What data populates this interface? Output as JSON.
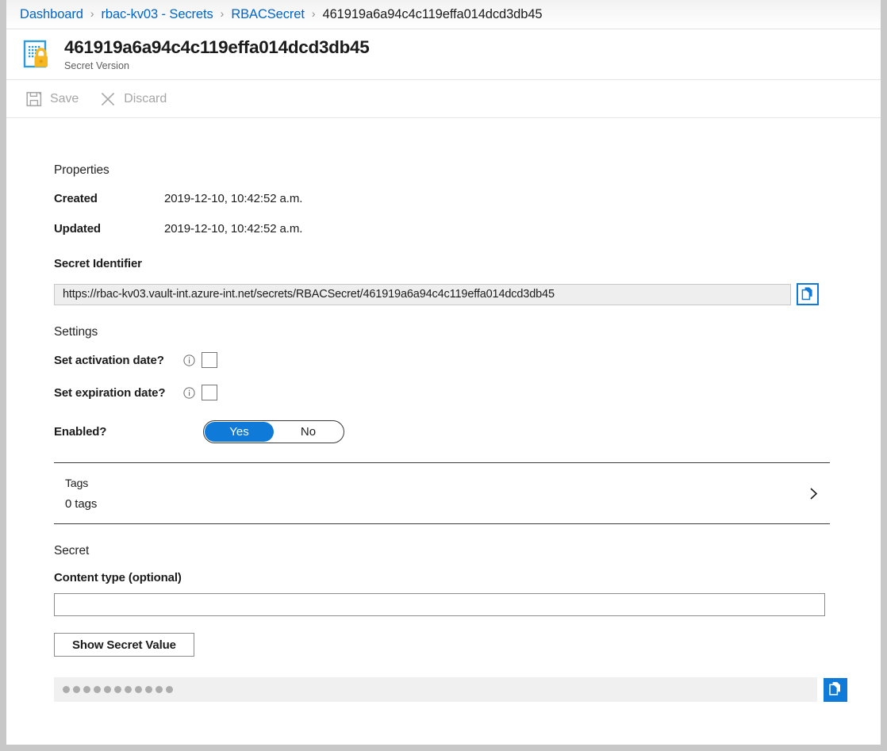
{
  "breadcrumb": {
    "items": [
      {
        "label": "Dashboard",
        "current": false
      },
      {
        "label": "rbac-kv03 - Secrets",
        "current": false
      },
      {
        "label": "RBACSecret",
        "current": false
      },
      {
        "label": "461919a6a94c4c119effa014dcd3db45",
        "current": true
      }
    ],
    "separator": "›"
  },
  "header": {
    "title": "461919a6a94c4c119effa014dcd3db45",
    "subtitle": "Secret Version",
    "icon": "secret-version-icon"
  },
  "command_bar": {
    "save_label": "Save",
    "save_icon": "save-floppy-icon",
    "save_disabled": true,
    "discard_label": "Discard",
    "discard_icon": "close-x-icon",
    "discard_disabled": true
  },
  "properties": {
    "heading": "Properties",
    "rows": [
      {
        "label": "Created",
        "value": "2019-12-10, 10:42:52 a.m."
      },
      {
        "label": "Updated",
        "value": "2019-12-10, 10:42:52 a.m."
      }
    ]
  },
  "secret_identifier": {
    "label": "Secret Identifier",
    "value": "https://rbac-kv03.vault-int.azure-int.net/secrets/RBACSecret/461919a6a94c4c119effa014dcd3db45",
    "copy_icon": "copy-icon"
  },
  "settings": {
    "heading": "Settings",
    "activation": {
      "label": "Set activation date?",
      "info_icon": "info-icon",
      "checked": false
    },
    "expiration": {
      "label": "Set expiration date?",
      "info_icon": "info-icon",
      "checked": false
    },
    "enabled": {
      "label": "Enabled?",
      "yes_label": "Yes",
      "no_label": "No",
      "selected": "Yes"
    }
  },
  "tags": {
    "title": "Tags",
    "count_text": "0 tags",
    "chevron_icon": "chevron-right-icon"
  },
  "secret": {
    "heading": "Secret",
    "content_type_label": "Content type (optional)",
    "content_type_value": "",
    "content_type_placeholder": "",
    "show_button_label": "Show Secret Value",
    "masked_value_dots": 11,
    "copy_icon": "copy-icon"
  },
  "colors": {
    "link": "#0066cc",
    "accent": "#0f7ad8",
    "icon_gold": "#f6b721",
    "icon_blue": "#2f9bd8",
    "disabled_text": "#a6a6a6"
  }
}
